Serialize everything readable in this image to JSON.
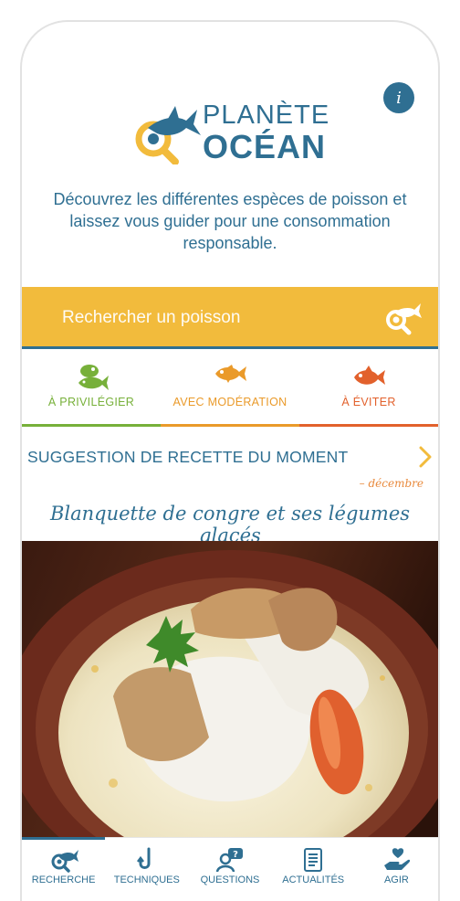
{
  "colors": {
    "primary": "#2f6f92",
    "yellow": "#f2bb3c",
    "green": "#77b03a",
    "orange": "#ea9a2a",
    "red": "#e2612c"
  },
  "header": {
    "logo_line1": "PLANÈTE",
    "logo_line2": "OCÉAN",
    "intro": "Découvrez les différentes espèces de poisson et laissez vous guider pour une consommation responsable."
  },
  "search": {
    "placeholder": "Rechercher un poisson",
    "icon": "fish-search-icon"
  },
  "categories": [
    {
      "label": "À PRIVILÉGIER",
      "icon": "green-fish-icon",
      "color": "#77b03a"
    },
    {
      "label": "AVEC MODÉRATION",
      "icon": "orange-fish-icon",
      "color": "#ea9a2a"
    },
    {
      "label": "À ÉVITER",
      "icon": "red-fish-icon",
      "color": "#e2612c"
    }
  ],
  "suggestion": {
    "title": "SUGGESTION DE RECETTE DU MOMENT",
    "month": "– décembre",
    "recipe_title": "Blanquette de congre et ses légumes glacés"
  },
  "tabbar": {
    "active": "RECHERCHE",
    "items": [
      {
        "label": "RECHERCHE",
        "icon": "search-fish-icon"
      },
      {
        "label": "TECHNIQUES",
        "icon": "hook-icon"
      },
      {
        "label": "QUESTIONS",
        "icon": "question-icon"
      },
      {
        "label": "ACTUALITÉS",
        "icon": "news-icon"
      },
      {
        "label": "AGIR",
        "icon": "heart-hand-icon"
      }
    ]
  }
}
